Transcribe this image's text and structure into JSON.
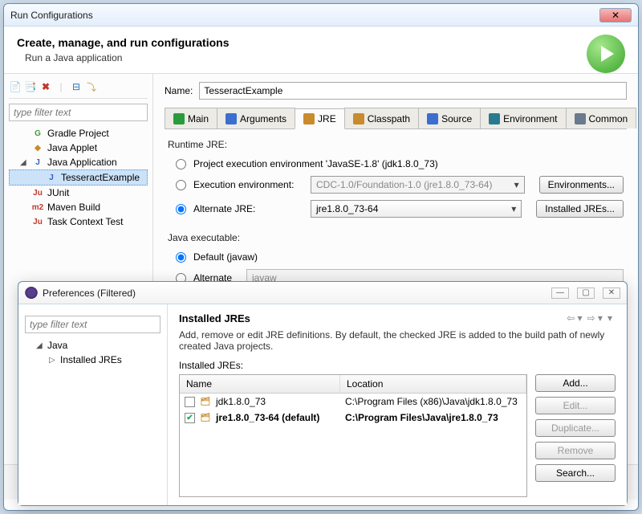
{
  "runwin": {
    "title": "Run Configurations",
    "header": "Create, manage, and run configurations",
    "subheader": "Run a Java application",
    "filter_placeholder": "type filter text",
    "tree": [
      {
        "label": "Gradle Project",
        "icon": "G",
        "color": "#3b9b3b"
      },
      {
        "label": "Java Applet",
        "icon": "◆",
        "color": "#c98b2d"
      },
      {
        "label": "Java Application",
        "icon": "J",
        "color": "#3260c4",
        "expanded": true,
        "children": [
          {
            "label": "TesseractExample",
            "icon": "J",
            "color": "#3260c4",
            "selected": true
          }
        ]
      },
      {
        "label": "JUnit",
        "icon": "Ju",
        "color": "#c0392b"
      },
      {
        "label": "Maven Build",
        "icon": "m2",
        "color": "#c0392b"
      },
      {
        "label": "Task Context Test",
        "icon": "Ju",
        "color": "#c0392b"
      }
    ],
    "name_label": "Name:",
    "name_value": "TesseractExample",
    "tabs": [
      "Main",
      "Arguments",
      "JRE",
      "Classpath",
      "Source",
      "Environment",
      "Common"
    ],
    "active_tab": "JRE",
    "runtime_label": "Runtime JRE:",
    "opt_project": "Project execution environment 'JavaSE-1.8' (jdk1.8.0_73)",
    "opt_exec_label": "Execution environment:",
    "opt_exec_value": "CDC-1.0/Foundation-1.0 (jre1.8.0_73-64)",
    "btn_envs": "Environments...",
    "opt_alt_label": "Alternate JRE:",
    "opt_alt_value": "jre1.8.0_73-64",
    "btn_installed": "Installed JREs...",
    "javaexec_label": "Java executable:",
    "javaexec_default": "Default (javaw)",
    "javaexec_alt": "Alternate",
    "javaexec_alt_value": "javaw"
  },
  "prefwin": {
    "title": "Preferences (Filtered)",
    "filter_placeholder": "type filter text",
    "tree_root": "Java",
    "tree_child": "Installed JREs",
    "heading": "Installed JREs",
    "desc": "Add, remove or edit JRE definitions. By default, the checked JRE is added to the build path of newly created Java projects.",
    "table_label": "Installed JREs:",
    "cols": [
      "Name",
      "Location"
    ],
    "rows": [
      {
        "checked": false,
        "name": "jdk1.8.0_73",
        "loc": "C:\\Program Files (x86)\\Java\\jdk1.8.0_73"
      },
      {
        "checked": true,
        "name": "jre1.8.0_73-64 (default)",
        "loc": "C:\\Program Files\\Java\\jre1.8.0_73",
        "selected": true
      }
    ],
    "buttons": [
      "Add...",
      "Edit...",
      "Duplicate...",
      "Remove",
      "Search..."
    ]
  }
}
